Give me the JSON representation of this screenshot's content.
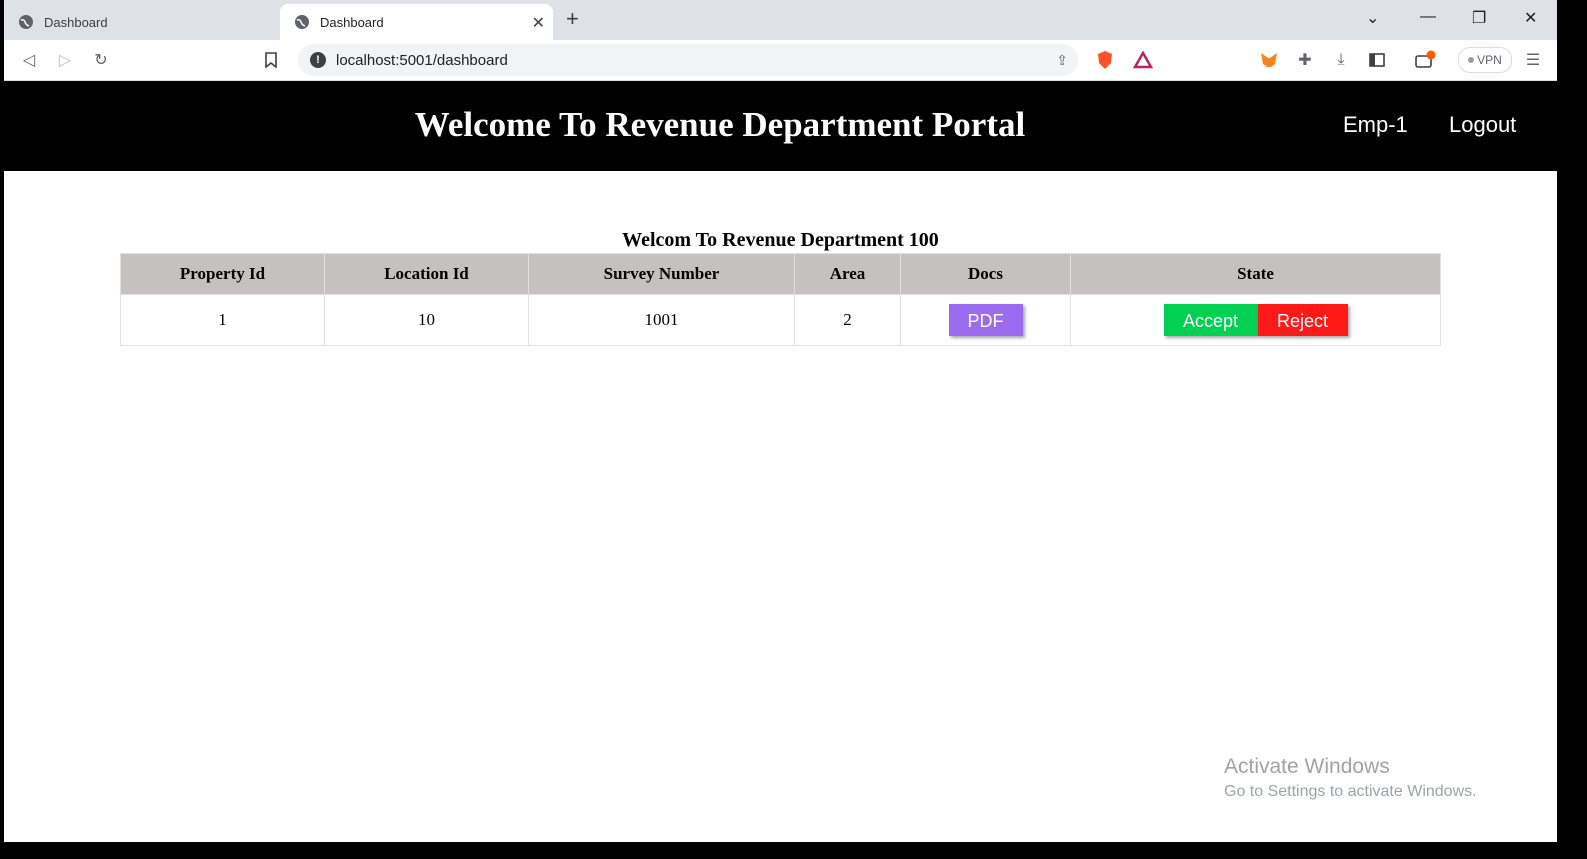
{
  "browser": {
    "tabs": [
      {
        "label": "Dashboard",
        "active": false
      },
      {
        "label": "Dashboard",
        "active": true
      }
    ],
    "url": "localhost:5001/dashboard",
    "vpn_label": "VPN"
  },
  "header": {
    "title": "Welcome To Revenue Department Portal",
    "user_link": "Emp-1",
    "logout_link": "Logout"
  },
  "main": {
    "caption": "Welcom To Revenue Department 100",
    "columns": [
      "Property Id",
      "Location Id",
      "Survey Number",
      "Area",
      "Docs",
      "State"
    ],
    "rows": [
      {
        "property_id": "1",
        "location_id": "10",
        "survey_number": "1001",
        "area": "2",
        "docs_label": "PDF",
        "accept_label": "Accept",
        "reject_label": "Reject"
      }
    ]
  },
  "watermark": {
    "line1": "Activate Windows",
    "line2": "Go to Settings to activate Windows."
  },
  "colors": {
    "header_bg": "#000000",
    "table_header_bg": "#c5c1c1",
    "pdf_button": "#9b6cf0",
    "accept_button": "#00d152",
    "reject_button": "#ff1a1a"
  }
}
